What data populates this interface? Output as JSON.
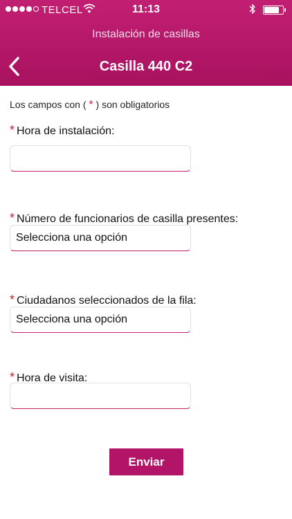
{
  "status_bar": {
    "carrier": "TELCEL",
    "time": "11:13",
    "battery_level": 0.75
  },
  "nav": {
    "subtitle": "Instalación de casillas",
    "title": "Casilla 440 C2",
    "back_icon": "chevron-left-icon"
  },
  "form": {
    "notice_prefix": "Los campos con (",
    "notice_star": "*",
    "notice_suffix": ") son obligatorios",
    "required_mark": "*",
    "fields": [
      {
        "label": "Hora de instalación:",
        "value": ""
      },
      {
        "label": "Número de funcionarios de casilla presentes:",
        "value": "Selecciona una opción"
      },
      {
        "label": "Ciudadanos seleccionados de la fila:",
        "value": "Selecciona una opción"
      },
      {
        "label": "Hora de visita:",
        "value": ""
      }
    ],
    "submit_label": "Enviar"
  },
  "colors": {
    "brand": "#b21467",
    "required": "#e0162b"
  }
}
